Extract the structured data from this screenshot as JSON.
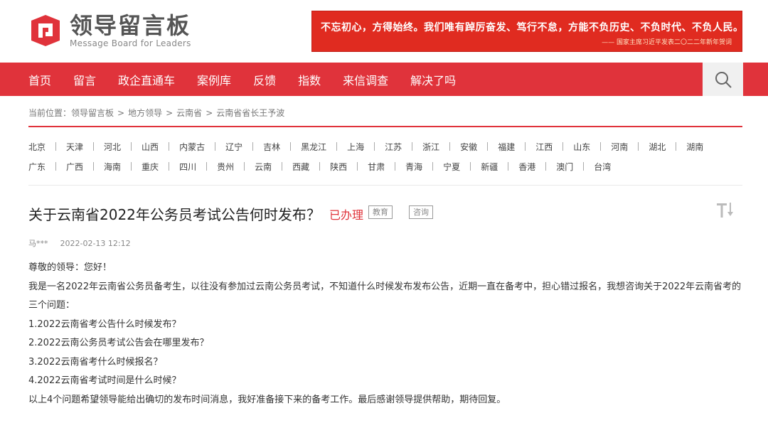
{
  "header": {
    "logo_title": "领导留言板",
    "logo_subtitle": "Message Board for Leaders",
    "banner_text": "不忘初心，方得始终。我们唯有踔厉奋发、笃行不怠，方能不负历史、不负时代、不负人民。",
    "banner_credit": "—— 国家主席习近平发表二〇二二年新年贺词"
  },
  "nav": {
    "items": [
      "首页",
      "留言",
      "政企直通车",
      "案例库",
      "反馈",
      "指数",
      "来信调查",
      "解决了吗"
    ],
    "search_icon": "search-icon"
  },
  "breadcrumb": {
    "label": "当前位置：",
    "items": [
      "领导留言板",
      "地方领导",
      "云南省",
      "云南省省长王予波"
    ],
    "separator": ">"
  },
  "provinces": {
    "row1": [
      "北京",
      "天津",
      "河北",
      "山西",
      "内蒙古",
      "辽宁",
      "吉林",
      "黑龙江",
      "上海",
      "江苏",
      "浙江",
      "安徽",
      "福建",
      "江西",
      "山东",
      "河南",
      "湖北",
      "湖南"
    ],
    "row2": [
      "广东",
      "广西",
      "海南",
      "重庆",
      "四川",
      "贵州",
      "云南",
      "西藏",
      "陕西",
      "甘肃",
      "青海",
      "宁夏",
      "新疆",
      "香港",
      "澳门",
      "台湾"
    ]
  },
  "message": {
    "title": "关于云南省2022年公务员考试公告何时发布？",
    "status": "已办理",
    "tags": [
      "教育",
      "咨询"
    ],
    "author": "马***",
    "date": "2022-02-13 12:12",
    "paragraphs": [
      "尊敬的领导：您好！",
      "我是一名2022年云南省公务员备考生，以往没有参加过云南公务员考试，不知道什么时候发布发布公告，近期一直在备考中，担心错过报名，我想咨询关于2022年云南省考的三个问题：",
      "1.2022云南省考公告什么时候发布？",
      "2.2022云南公务员考试公告会在哪里发布？",
      "3.2022云南省考什么时候报名？",
      "4.2022云南省考试时间是什么时候？",
      "以上4个问题希望领导能给出确切的发布时间消息，我好准备接下来的备考工作。最后感谢领导提供帮助，期待回复。"
    ]
  },
  "colors": {
    "accent_red": "#e0333b",
    "banner_red": "#e02b20"
  }
}
